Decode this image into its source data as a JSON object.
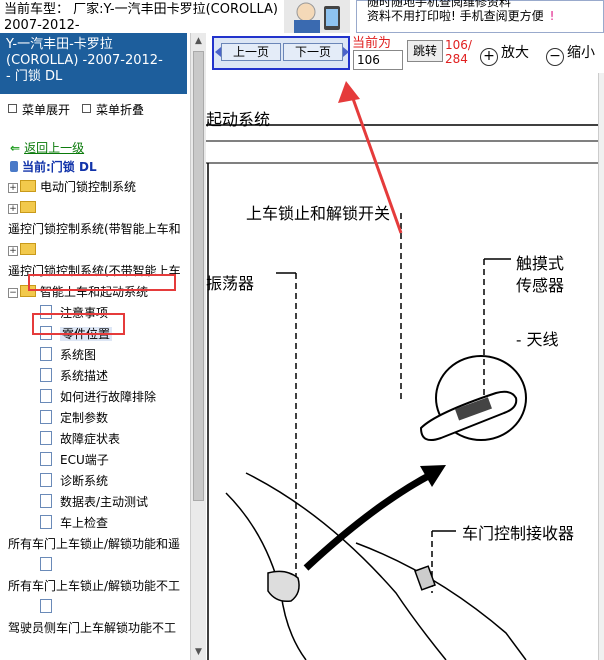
{
  "header": {
    "vehicle_line1": "当前车型： 厂家:Y-一汽丰田卡罗拉(COROLLA)",
    "vehicle_line2": "2007-2012-"
  },
  "ad": {
    "line1": "随时随地手机查阅维修资料",
    "line2": "资料不用打印啦! 手机查阅更方便"
  },
  "sidebar": {
    "title_line1": "Y-一汽丰田-卡罗拉",
    "title_line2": "(COROLLA) -2007-2012-",
    "title_line3": "- 门锁 DL",
    "expand_label": "菜单展开",
    "collapse_label": "菜单折叠",
    "back_label": "返回上一级",
    "current_label": "当前:门锁 DL",
    "tree": [
      {
        "label": "电动门锁控制系统",
        "type": "folder"
      },
      {
        "label": "",
        "type": "folder"
      },
      {
        "label": "遥控门锁控制系统(带智能上车和",
        "type": "text"
      },
      {
        "label": "",
        "type": "folder"
      },
      {
        "label": "遥控门锁控制系统(不带智能上车",
        "type": "text"
      },
      {
        "label": "智能上车和起动系统",
        "type": "folder-open"
      },
      {
        "label": "注意事项",
        "type": "doc"
      },
      {
        "label": "零件位置",
        "type": "doc",
        "selected": true
      },
      {
        "label": "系统图",
        "type": "doc"
      },
      {
        "label": "系统描述",
        "type": "doc"
      },
      {
        "label": "如何进行故障排除",
        "type": "doc"
      },
      {
        "label": "定制参数",
        "type": "doc"
      },
      {
        "label": "故障症状表",
        "type": "doc"
      },
      {
        "label": "ECU端子",
        "type": "doc"
      },
      {
        "label": "诊断系统",
        "type": "doc"
      },
      {
        "label": "数据表/主动测试",
        "type": "doc"
      },
      {
        "label": "车上检查",
        "type": "doc"
      },
      {
        "label": "所有车门上车锁止/解锁功能和遥",
        "type": "text"
      },
      {
        "label": "",
        "type": "doc"
      },
      {
        "label": "所有车门上车锁止/解锁功能不工",
        "type": "text"
      },
      {
        "label": "",
        "type": "doc"
      },
      {
        "label": "驾驶员侧车门上车解锁功能不工",
        "type": "text"
      }
    ]
  },
  "toolbar": {
    "prev_label": "上一页",
    "next_label": "下一页",
    "current_page_label": "当前为",
    "page_value": "106",
    "jump_label": "跳转",
    "page_count": "106/\n284",
    "zoom_in_label": "放大",
    "zoom_out_label": "缩小"
  },
  "document": {
    "heading": "起动系统",
    "label_switch": "上车锁止和解锁开关",
    "label_oscillator": "振荡器",
    "label_sensor_1": "触摸式",
    "label_sensor_2": "传感器",
    "label_antenna": "- 天线",
    "label_receiver": "车门控制接收器"
  },
  "colors": {
    "title_bg": "#1d5e9c",
    "highlight": "#e53b3b",
    "nav_frame": "#2233cc",
    "page_red": "#e02020",
    "back_green": "#0a7a0a"
  }
}
